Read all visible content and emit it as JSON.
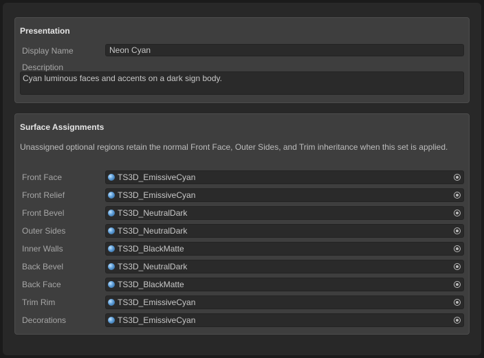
{
  "presentation": {
    "title": "Presentation",
    "display_name_label": "Display Name",
    "display_name_value": "Neon Cyan",
    "description_label": "Description",
    "description_value": "Cyan luminous faces and accents on a dark sign body."
  },
  "surfaces": {
    "title": "Surface Assignments",
    "help": "Unassigned optional regions retain the normal Front Face, Outer Sides, and Trim inheritance when this set is applied.",
    "rows": [
      {
        "label": "Front Face",
        "material": "TS3D_EmissiveCyan"
      },
      {
        "label": "Front Relief",
        "material": "TS3D_EmissiveCyan"
      },
      {
        "label": "Front Bevel",
        "material": "TS3D_NeutralDark"
      },
      {
        "label": "Outer Sides",
        "material": "TS3D_NeutralDark"
      },
      {
        "label": "Inner Walls",
        "material": "TS3D_BlackMatte"
      },
      {
        "label": "Back Bevel",
        "material": "TS3D_NeutralDark"
      },
      {
        "label": "Back Face",
        "material": "TS3D_BlackMatte"
      },
      {
        "label": "Trim Rim",
        "material": "TS3D_EmissiveCyan"
      },
      {
        "label": "Decorations",
        "material": "TS3D_EmissiveCyan"
      }
    ],
    "material_icon": "material-sphere-icon",
    "picker_icon": "object-picker-icon"
  }
}
